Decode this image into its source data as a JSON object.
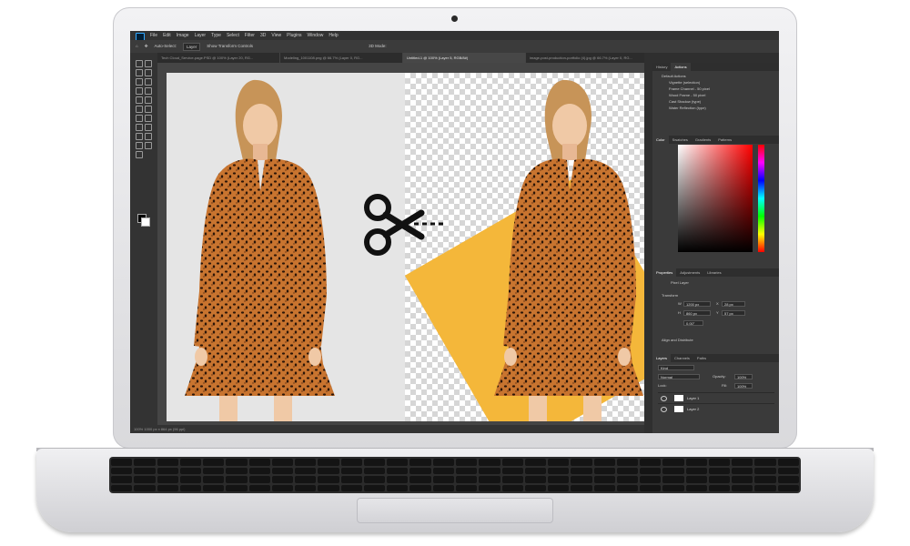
{
  "app": {
    "menu": [
      "File",
      "Edit",
      "Image",
      "Layer",
      "Type",
      "Select",
      "Filter",
      "3D",
      "View",
      "Plugins",
      "Window",
      "Help"
    ]
  },
  "options_bar": {
    "auto_select_label": "Auto-Select:",
    "auto_select_value": "Layer",
    "transform_label": "Show Transform Controls",
    "mode_label": "3D Mode:"
  },
  "doc_tabs": [
    {
      "label": "Tech Cloud_Service-page.PSD @ 100% (Layer 20, RG...",
      "active": false
    },
    {
      "label": "Modeling_1001108.png @ 66.7% (Layer 0, RG...",
      "active": false
    },
    {
      "label": "Untitled-1 @ 100% (Layer 5, RGB/8#)",
      "active": true
    },
    {
      "label": "image-post-production-portfolio (4).jpg @ 66.7% (Layer 0, RG...",
      "active": false
    }
  ],
  "status_bar": "100%    1000 px x 864 px (96 ppi)",
  "history_panel": {
    "tabs": [
      "History",
      "Actions"
    ],
    "actions": [
      "Default Actions",
      "Vignette (selection)",
      "Frame Channel - 50 pixel",
      "Wood Frame - 50 pixel",
      "Cast Shadow (type)",
      "Water Reflection (type)"
    ]
  },
  "color_panel": {
    "tabs": [
      "Color",
      "Swatches",
      "Gradients",
      "Patterns"
    ],
    "accent": "#ff0000"
  },
  "properties_panel": {
    "tabs": [
      "Properties",
      "Adjustments",
      "Libraries"
    ],
    "layer_type": "Pixel Layer",
    "section_transform": "Transform",
    "w_label": "W",
    "w_value": "1200 px",
    "h_label": "H",
    "h_value": "860 px",
    "x_label": "X",
    "x_value": "28 px",
    "y_label": "Y",
    "y_value": "57 px",
    "angle_value": "0.00°",
    "section_align": "Align and Distribute"
  },
  "layers_panel": {
    "tabs": [
      "Layers",
      "Channels",
      "Paths"
    ],
    "filter_kind": "Kind",
    "blend_mode": "Normal",
    "opacity_label": "Opacity:",
    "opacity_value": "100%",
    "lock_label": "Lock:",
    "fill_label": "Fill:",
    "fill_value": "100%",
    "layers": [
      {
        "name": "Layer 1"
      },
      {
        "name": "Layer 2"
      }
    ]
  },
  "canvas": {
    "dress_color": "#c8742f",
    "highlight_color": "#f4b73a"
  }
}
